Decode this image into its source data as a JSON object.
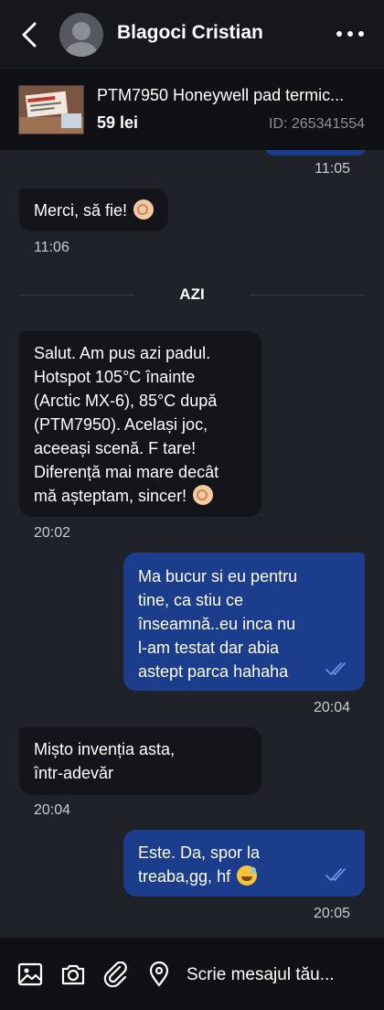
{
  "header": {
    "contact_name": "Blagoci Cristian",
    "icons": {
      "back": "chevron-left-icon",
      "menu": "more-horizontal-icon"
    }
  },
  "product": {
    "title": "PTM7950 Honeywell pad termic...",
    "price": "59 lei",
    "id": "ID: 265341554"
  },
  "messages": [
    {
      "side": "out",
      "text": "",
      "time": "11:05"
    },
    {
      "side": "in",
      "text": "Merci, să fie!",
      "emoji": "ok-hand",
      "time": "11:06"
    },
    {
      "side": "divider",
      "text": "AZI"
    },
    {
      "side": "in",
      "text": "Salut. Am pus azi padul.\nHotspot 105°C înainte\n(Arctic MX-6), 85°C după\n(PTM7950). Același joc,\naceeași scenă. F tare!\nDiferență mai mare decât\nmă așteptam, sincer!",
      "emoji": "ok-hand",
      "time": "20:02"
    },
    {
      "side": "out",
      "text": "Ma bucur si eu pentru\ntine, ca stiu ce\nînseamnă..eu inca nu\nl-am testat dar abia\nastept parca hahaha",
      "time": "20:04",
      "read": true
    },
    {
      "side": "in",
      "text": "Mișto invenția asta,\nîntr-adevăr",
      "time": "20:04"
    },
    {
      "side": "out",
      "text": "Este. Da, spor la\ntreaba,gg, hf",
      "emoji": "grinning-sweat",
      "time": "20:05",
      "read": true
    }
  ],
  "composer": {
    "placeholder": "Scrie mesajul tău...",
    "icons": [
      "image-icon",
      "camera-icon",
      "paperclip-icon",
      "location-pin-icon"
    ]
  },
  "colors": {
    "background": "#1f2229",
    "header": "#15171d",
    "incoming_bubble": "#13151b",
    "outgoing_bubble": "#1c3c8c",
    "read_check": "#6f8fe8"
  }
}
